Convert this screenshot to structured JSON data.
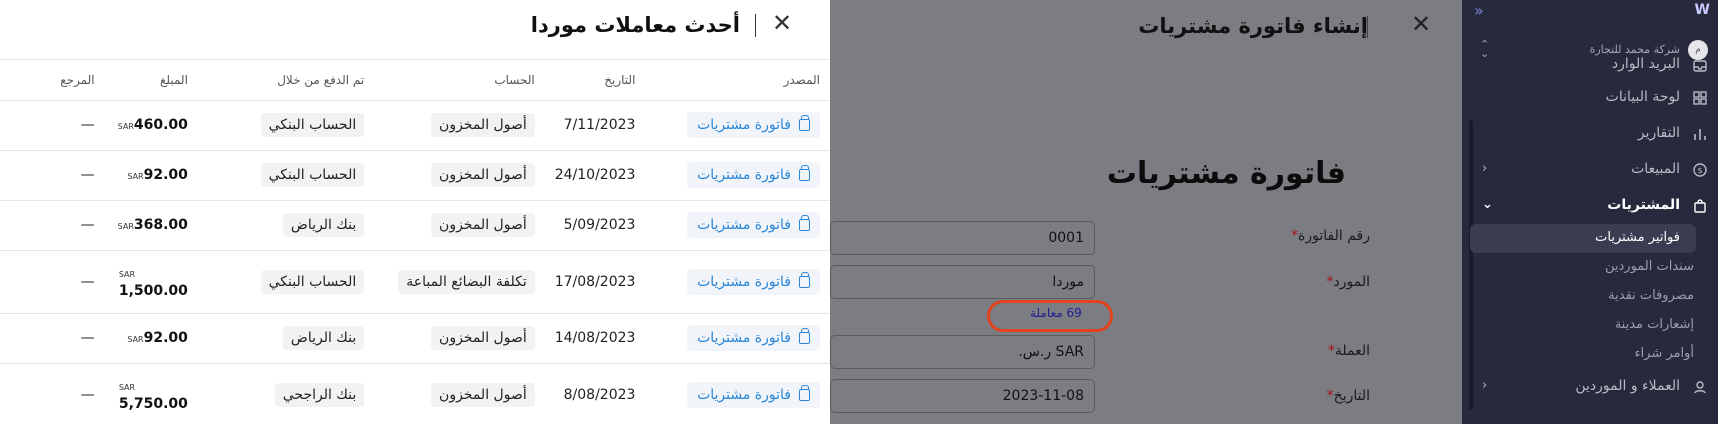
{
  "sidebar": {
    "logo": "W",
    "collapse_icon": "double-chevron-left-icon",
    "company": {
      "name": "شركة محمد للتجارة",
      "avatar": "م"
    },
    "items": [
      {
        "label": "البريد الوارد",
        "icon": "inbox-icon"
      },
      {
        "label": "لوحة البيانات",
        "icon": "dashboard-icon"
      },
      {
        "label": "التقارير",
        "icon": "chart-icon"
      },
      {
        "label": "المبيعات",
        "icon": "currency-icon"
      },
      {
        "label": "المشتريات",
        "icon": "bag-icon"
      }
    ],
    "sub_items": [
      {
        "label": "فواتير مشتريات"
      },
      {
        "label": "سندات الموردين"
      },
      {
        "label": "مصروفات نقدية"
      },
      {
        "label": "إشعارات مدينة"
      },
      {
        "label": "أوامر شراء"
      }
    ],
    "bottom_item": {
      "label": "العملاء و الموردين"
    }
  },
  "invoice": {
    "header_title": "إنشاء فاتورة مشتريات",
    "page_title": "فاتورة مشتريات",
    "fields": {
      "invoice_number": {
        "label": "رقم الفاتورة",
        "value": "0001"
      },
      "supplier": {
        "label": "المورد",
        "value": "موردا"
      },
      "currency": {
        "label": "العملة",
        "value": "SAR ر.س."
      },
      "date": {
        "label": "التاريخ",
        "value": "2023-11-08"
      }
    },
    "transactions_link": "69 معاملة"
  },
  "drawer": {
    "title": "أحدث معاملات موردا",
    "columns": {
      "source": "المصدر",
      "date": "التاريخ",
      "account": "الحساب",
      "paid_via": "تم الدفع من خلال",
      "amount": "المبلغ",
      "reference": "المرجع"
    },
    "rows": [
      {
        "source": "فاتورة مشتريات",
        "date": "7/11/2023",
        "account": "أصول المخزون",
        "paid_via": "الحساب البنكي",
        "currency": "SAR",
        "amount": "460.00",
        "reference": "—"
      },
      {
        "source": "فاتورة مشتريات",
        "date": "24/10/2023",
        "account": "أصول المخزون",
        "paid_via": "الحساب البنكي",
        "currency": "SAR",
        "amount": "92.00",
        "reference": "—"
      },
      {
        "source": "فاتورة مشتريات",
        "date": "5/09/2023",
        "account": "أصول المخزون",
        "paid_via": "بنك الرياض",
        "currency": "SAR",
        "amount": "368.00",
        "reference": "—"
      },
      {
        "source": "فاتورة مشتريات",
        "date": "17/08/2023",
        "account": "تكلفة البضائع المباعة",
        "paid_via": "الحساب البنكي",
        "currency": "SAR",
        "amount": "1,500.00",
        "reference": "—"
      },
      {
        "source": "فاتورة مشتريات",
        "date": "14/08/2023",
        "account": "أصول المخزون",
        "paid_via": "بنك الرياض",
        "currency": "SAR",
        "amount": "92.00",
        "reference": "—"
      },
      {
        "source": "فاتورة مشتريات",
        "date": "8/08/2023",
        "account": "أصول المخزون",
        "paid_via": "بنك الراجحي",
        "currency": "SAR",
        "amount": "5,750.00",
        "reference": "—"
      }
    ]
  }
}
